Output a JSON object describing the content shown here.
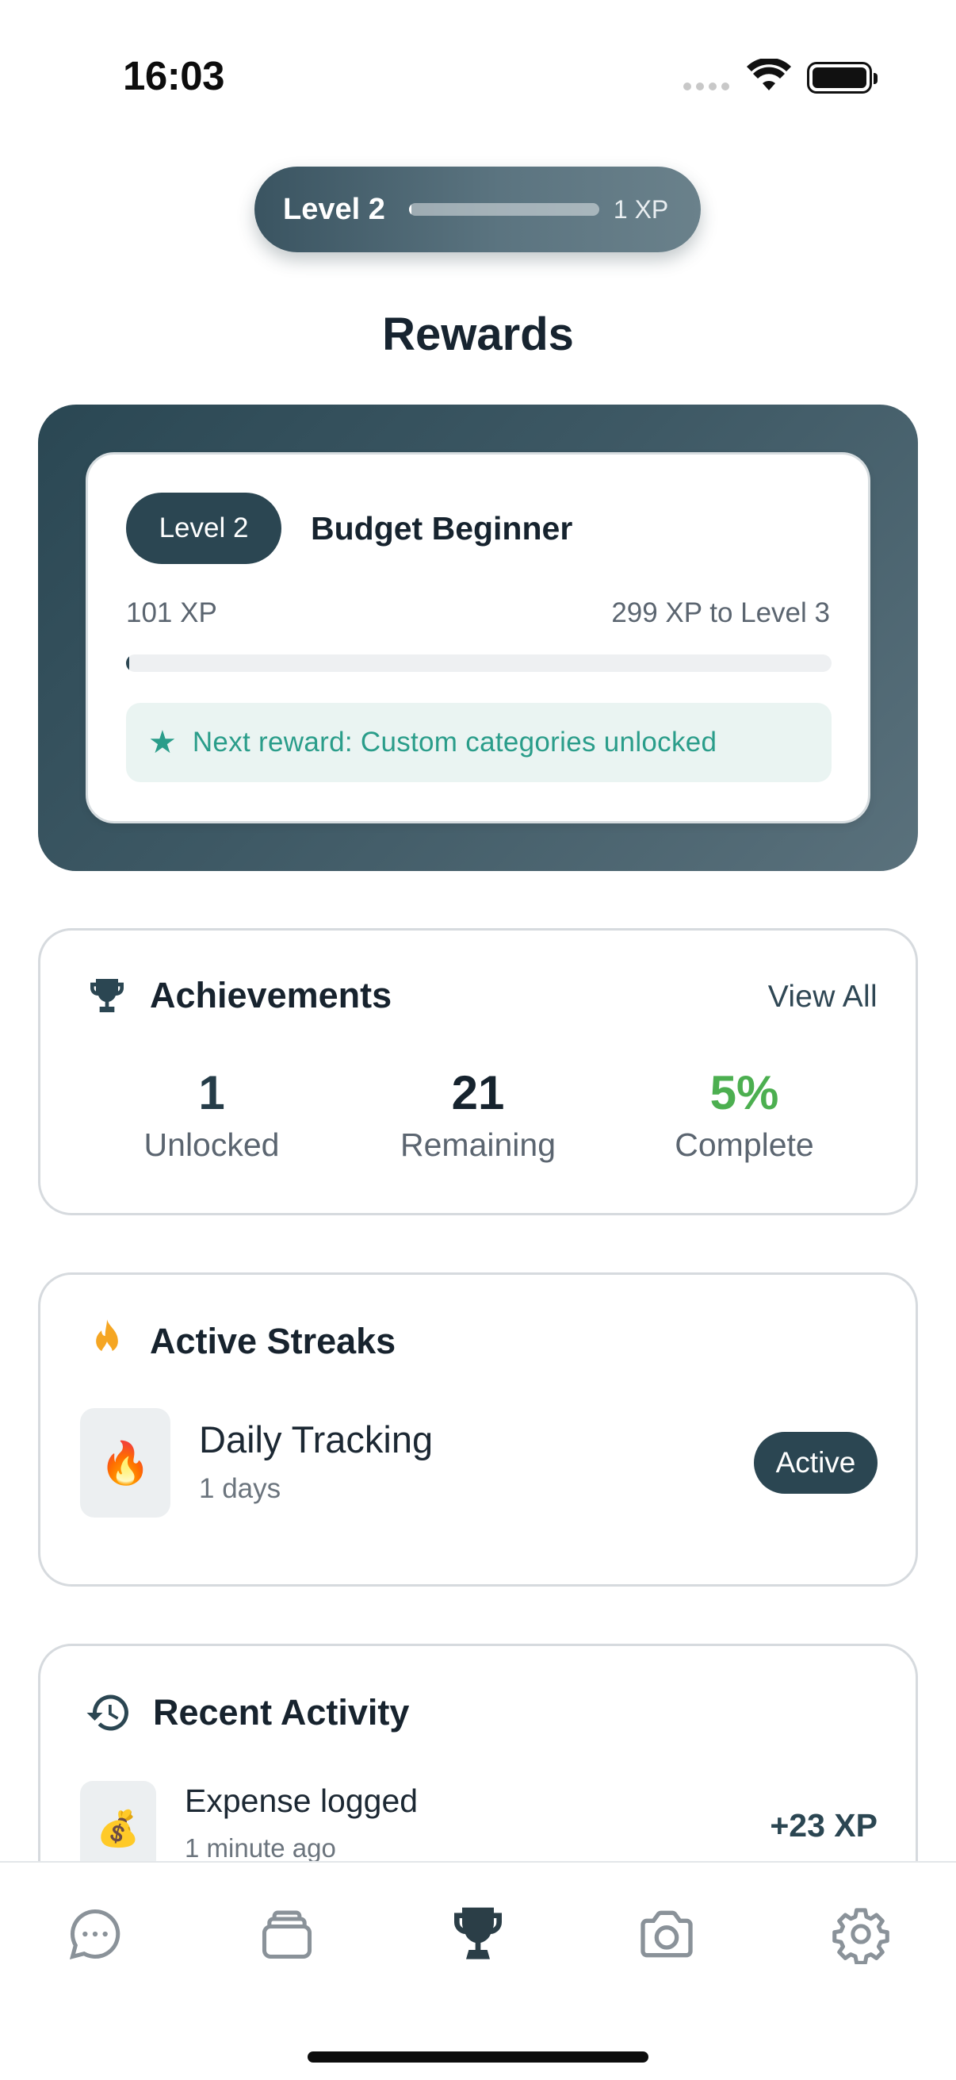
{
  "status_bar": {
    "time": "16:03"
  },
  "level_pill": {
    "label": "Level 2",
    "xp": "1 XP",
    "progress": 0.01
  },
  "page": {
    "title": "Rewards"
  },
  "level_card": {
    "badge": "Level 2",
    "name": "Budget Beginner",
    "xp_current": "101 XP",
    "xp_to_next": "299 XP to Level 3",
    "progress": 0.005,
    "next_reward": "Next reward: Custom categories unlocked"
  },
  "achievements": {
    "title": "Achievements",
    "view_all": "View All",
    "stats": [
      {
        "value": "1",
        "label": "Unlocked"
      },
      {
        "value": "21",
        "label": "Remaining"
      },
      {
        "value": "5%",
        "label": "Complete"
      }
    ]
  },
  "streaks": {
    "title": "Active Streaks",
    "items": [
      {
        "name": "Daily Tracking",
        "days": "1 days",
        "status": "Active",
        "icon": "fire-icon"
      }
    ]
  },
  "recent_activity": {
    "title": "Recent Activity",
    "items": [
      {
        "name": "Expense logged",
        "time": "1 minute ago",
        "xp": "+23 XP",
        "icon": "money-bag-icon"
      }
    ]
  },
  "tab_bar": {
    "tabs": [
      {
        "icon": "chat-icon",
        "active": false
      },
      {
        "icon": "wallet-icon",
        "active": false
      },
      {
        "icon": "trophy-icon",
        "active": true
      },
      {
        "icon": "camera-icon",
        "active": false
      },
      {
        "icon": "settings-icon",
        "active": false
      }
    ]
  },
  "colors": {
    "primary": "#2b4652",
    "accent_teal": "#2a9d8a",
    "success_green": "#4caf50",
    "streak_orange": "#f5a623"
  }
}
